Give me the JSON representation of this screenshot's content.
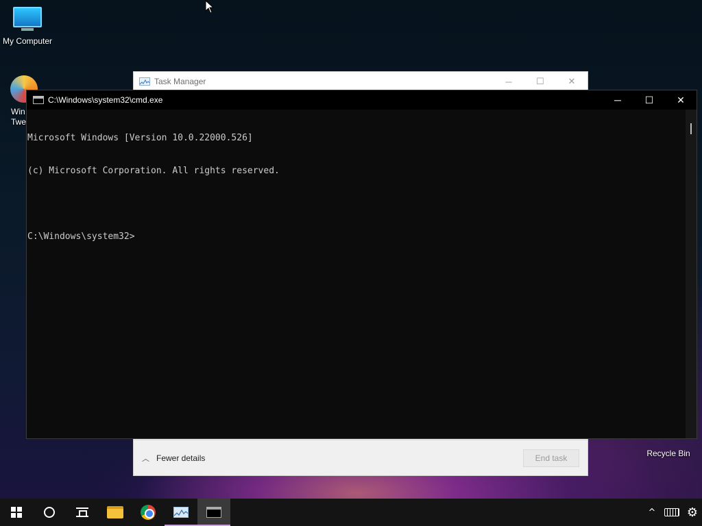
{
  "desktop": {
    "icons": [
      {
        "label": "My Computer"
      },
      {
        "label_line1": "Win",
        "label_line2": "Twe"
      },
      {
        "label": "Recycle Bin"
      }
    ]
  },
  "task_manager": {
    "title": "Task Manager",
    "fewer_details_label": "Fewer details",
    "end_task_label": "End task"
  },
  "cmd": {
    "title": "C:\\Windows\\system32\\cmd.exe",
    "lines": [
      "Microsoft Windows [Version 10.0.22000.526]",
      "(c) Microsoft Corporation. All rights reserved.",
      "",
      "C:\\Windows\\system32>"
    ]
  },
  "window_controls": {
    "minimize": "─",
    "maximize": "☐",
    "close": "✕"
  },
  "taskbar": {
    "tray": {
      "chevron": "^",
      "gear": "⚙"
    }
  },
  "colors": {
    "console_text": "#cccccc",
    "console_bg": "#0c0c0c",
    "taskbar_bg": "#141414",
    "active_underline": "#c8a2d8"
  }
}
